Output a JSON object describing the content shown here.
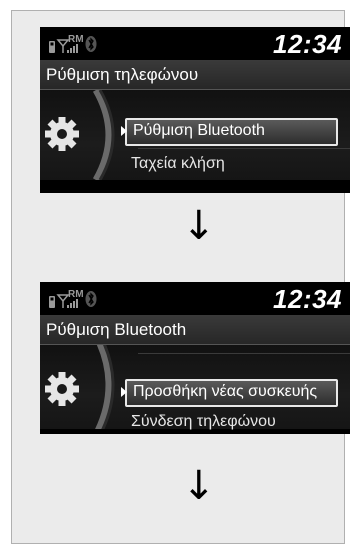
{
  "screens": [
    {
      "clock": "12:34",
      "title": "Ρύθμιση τηλεφώνου",
      "menu": [
        {
          "label": "Ρύθμιση Bluetooth",
          "selected": true
        },
        {
          "label": "Ταχεία κλήση",
          "selected": false
        }
      ]
    },
    {
      "clock": "12:34",
      "title": "Ρύθμιση Bluetooth",
      "menu": [
        {
          "label": "Προσθήκη νέας συσκευής",
          "selected": true
        },
        {
          "label": "Σύνδεση τηλεφώνου",
          "selected": false
        }
      ]
    }
  ],
  "status": {
    "network_label": "RM",
    "icons": [
      "phone-icon",
      "signal-strength-icon",
      "bluetooth-icon"
    ]
  },
  "arrows": [
    "↓",
    "↓"
  ],
  "icons": {
    "settings": "gear-icon"
  },
  "colors": {
    "screen_bg": "#000000",
    "text": "#ffffff",
    "frame_bg": "#ebebeb"
  }
}
